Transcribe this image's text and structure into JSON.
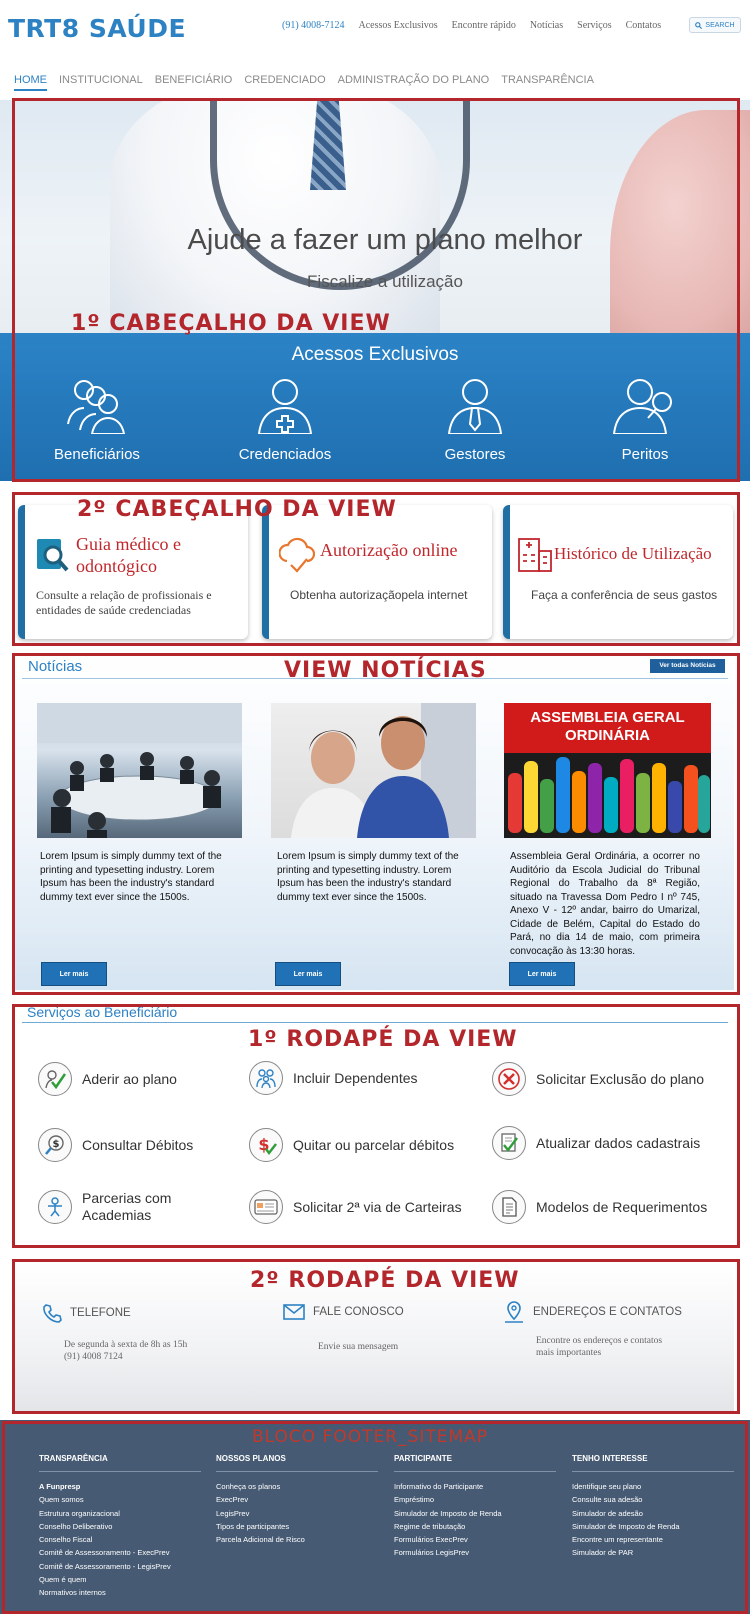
{
  "header": {
    "logo": "TRT8 SAÚDE",
    "phone": "(91) 4008-7124",
    "links": [
      "Acessos Exclusivos",
      "Encontre rápido",
      "Notícias",
      "Serviços",
      "Contatos"
    ],
    "search_label": "SEARCH"
  },
  "nav": [
    "HOME",
    "INSTITUCIONAL",
    "BENEFICIÁRIO",
    "CREDENCIADO",
    "ADMINISTRAÇÃO DO PLANO",
    "TRANSPARÊNCIA"
  ],
  "hero": {
    "title": "Ajude a fazer um plano melhor",
    "subtitle": "Fiscalize a utilização"
  },
  "access": {
    "title": "Acessos Exclusivos",
    "items": [
      "Beneficiários",
      "Credenciados",
      "Gestores",
      "Peritos"
    ]
  },
  "cards": [
    {
      "title": "Guia médico e odontógico",
      "desc": "Consulte a relação de profissionais e entidades de saúde credenciadas"
    },
    {
      "title": "Autorização online",
      "desc": "Obtenha autorizaçãopela internet"
    },
    {
      "title": "Histórico de Utilização",
      "desc": "Faça a conferência de seus gastos"
    }
  ],
  "news": {
    "title": "Notícias",
    "view_all": "Ver todas Notícias",
    "items": [
      {
        "text": "Lorem Ipsum is simply dummy text of the printing and typesetting industry. Lorem Ipsum has been the industry's standard dummy text ever since the 1500s.",
        "button": "Ler mais"
      },
      {
        "text": "Lorem Ipsum is simply dummy text of the printing and typesetting industry. Lorem Ipsum has been the industry's standard dummy text ever since the 1500s.",
        "button": "Ler mais"
      },
      {
        "text": "Assembleia Geral Ordinária, a ocorrer no Auditório da Escola Judicial do Tribunal Regional do Trabalho da 8ª Região, situado na Travessa Dom Pedro I nº 745, Anexo V - 12º andar, bairro do Umarizal, Cidade de Belém, Capital do Estado do Pará, no dia 14 de maio, com primeira convocação às 13:30 horas.",
        "button": "Ler mais",
        "banner": "ASSEMBLEIA GERAL ORDINÁRIA"
      }
    ]
  },
  "services": {
    "title": "Serviços ao Beneficiário",
    "items": [
      "Aderir ao plano",
      "Incluir Dependentes",
      "Solicitar Exclusão do plano",
      "Consultar Débitos",
      "Quitar ou parcelar débitos",
      "Atualizar dados cadastrais",
      "Parcerias com Academias",
      "Solicitar 2ª via de Carteiras",
      "Modelos de Requerimentos"
    ]
  },
  "contact": {
    "phone_title": "TELEFONE",
    "phone_text1": "De segunda à sexta de 8h as 15h",
    "phone_text2": "(91) 4008 7124",
    "mail_title": "FALE CONOSCO",
    "mail_text": "Envie sua mensagem",
    "addr_title": "ENDEREÇOS E CONTATOS",
    "addr_text1": "Encontre os endereços e contatos",
    "addr_text2": "mais importantes"
  },
  "sitemap": {
    "cols": [
      {
        "title": "TRANSPARÊNCIA",
        "items": [
          "A Funpresp",
          "Quem somos",
          "Estrutura organizacional",
          "Conselho Deliberativo",
          "Conselho Fiscal",
          "Comitê de Assessoramento - ExecPrev",
          "Comitê de Assessoramento - LegisPrev",
          "Quem é quem",
          "Normativos internos"
        ]
      },
      {
        "title": "NOSSOS PLANOS",
        "items": [
          "Conheça os planos",
          "ExecPrev",
          "LegisPrev",
          "Tipos de participantes",
          "Parcela Adicional de Risco"
        ]
      },
      {
        "title": "PARTICIPANTE",
        "items": [
          "Informativo do Participante",
          "Empréstimo",
          "Simulador de Imposto de Renda",
          "Regime de tributação",
          "Formulários ExecPrev",
          "Formulários LegisPrev"
        ]
      },
      {
        "title": "TENHO INTERESSE",
        "items": [
          "Identifique seu plano",
          "Consulte sua adesão",
          "Simulador de adesão",
          "Simulador de Imposto de Renda",
          "Encontre um representante",
          "Simulador de PAR"
        ]
      }
    ]
  },
  "annotations": {
    "a1": "1º CABEÇALHO DA VIEW",
    "a2": "2º CABEÇALHO DA VIEW",
    "a3": "VIEW NOTÍCIAS",
    "a4": "1º RODAPÉ DA VIEW",
    "a5": "2º RODAPÉ DA VIEW",
    "a6": "BLOCO FOOTER_SITEMAP"
  },
  "colors": {
    "brand": "#2d82c4",
    "annotation": "#b3262b",
    "card_title": "#c0272d",
    "sitemap_bg": "#475a73"
  }
}
